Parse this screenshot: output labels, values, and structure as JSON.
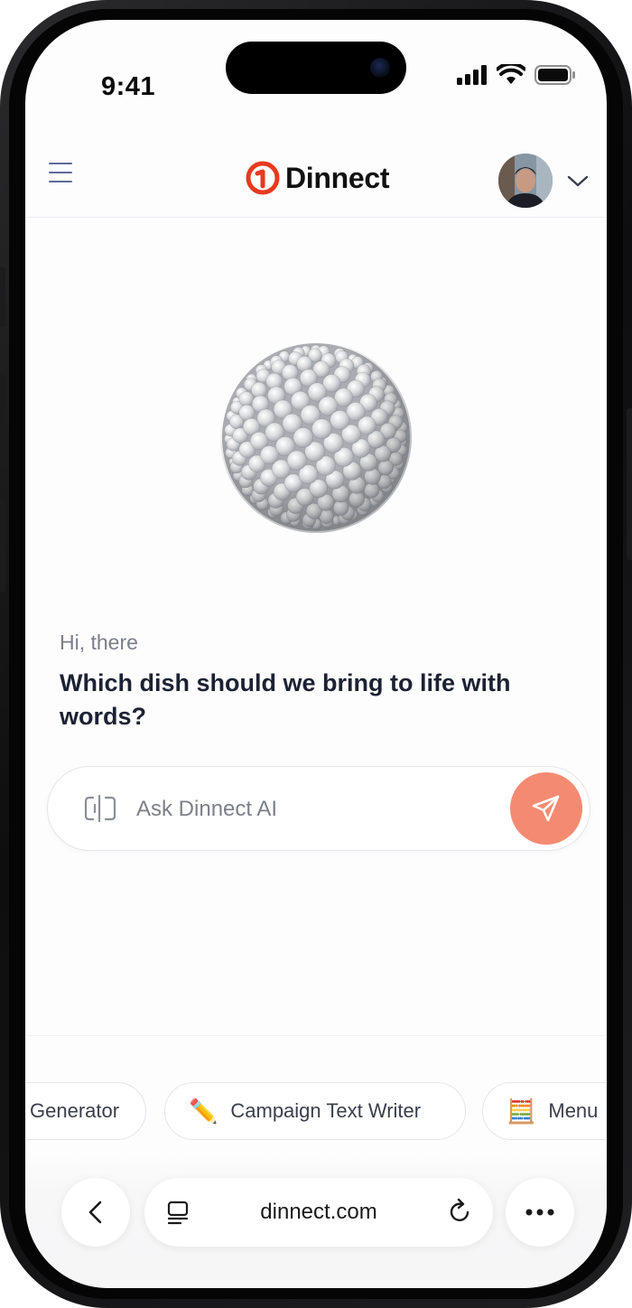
{
  "status_bar": {
    "time": "9:41",
    "icons": [
      "signal-icon",
      "wifi-icon",
      "battery-icon"
    ]
  },
  "header": {
    "brand_name": "Dinnect",
    "menu_icon": "hamburger-menu-icon",
    "avatar_alt": "User avatar",
    "dropdown_icon": "chevron-down-icon"
  },
  "hero": {
    "greeting": "Hi, there",
    "headline": "Which dish should we bring to life with words?"
  },
  "ask": {
    "placeholder": "Ask Dinnect AI",
    "value": "",
    "send_icon": "paper-plane-icon"
  },
  "chips": [
    {
      "label": "Generator",
      "emoji": ""
    },
    {
      "label": "Campaign Text Writer",
      "emoji": "✏️"
    },
    {
      "label": "Menu",
      "emoji": "🧮"
    }
  ],
  "browser": {
    "url": "dinnect.com",
    "back_icon": "back-arrow-icon",
    "tabs_icon": "tabs-icon",
    "reload_icon": "reload-icon",
    "more_icon": "more-dots-icon"
  },
  "colors": {
    "brand_red": "#e8391f",
    "send_button": "#f58a72",
    "headline_text": "#1c2233",
    "muted_text": "#7a7f88"
  }
}
